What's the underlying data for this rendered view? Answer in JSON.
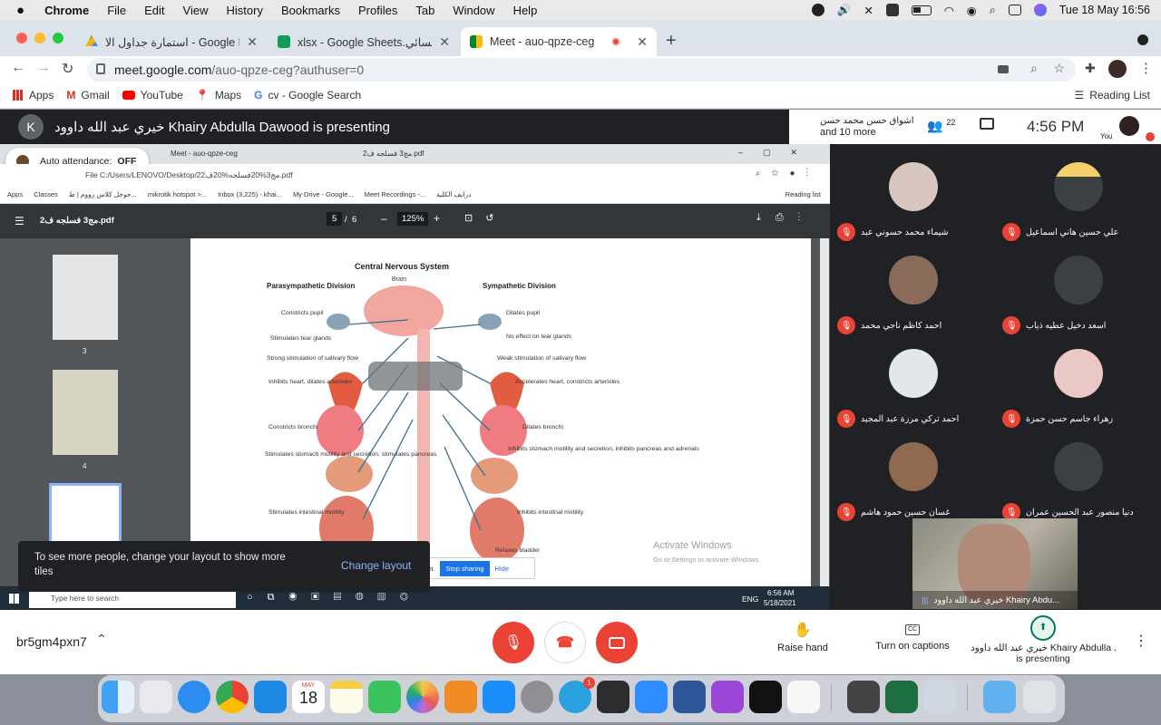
{
  "menubar": {
    "app": "Chrome",
    "items": [
      "File",
      "Edit",
      "View",
      "History",
      "Bookmarks",
      "Profiles",
      "Tab",
      "Window",
      "Help"
    ],
    "datetime": "Tue 18 May  16:56"
  },
  "tabs": [
    {
      "title": "استمارة جداول الا - Google Drive"
    },
    {
      "title": "xlsx - Google Sheets.المسائي"
    },
    {
      "title": "Meet - auo-qpze-ceg"
    }
  ],
  "address": {
    "host": "meet.google.com",
    "path": "/auo-qpze-ceg?authuser=0"
  },
  "bookmarks": {
    "items": [
      "Apps",
      "Gmail",
      "YouTube",
      "Maps",
      "cv - Google Search"
    ],
    "reading_list": "Reading List"
  },
  "presenter_bar": {
    "avatar_letter": "K",
    "text": "خيري عبد الله داوود Khairy Abdulla Dawood is presenting",
    "top_speaker": "اشواق حسن محمد حسن",
    "others": "and 10 more",
    "people_count": "22",
    "time": "4:56 PM",
    "you_label": "You"
  },
  "auto_attendance": {
    "label": "Auto attendance:",
    "state": "OFF"
  },
  "shared_screen": {
    "inner_tabs": [
      "Meet - auo-qpze-ceg",
      "مج3 فسلجه ف2.pdf"
    ],
    "inner_url": "File  C:/Users/LENOVO/Desktop/2مج3%20فسلجه%20ف2.pdf",
    "inner_bookmarks": [
      "Apps",
      "Classes",
      "جوجل كلاس رووم | ط...",
      "mikrotik hotspot >...",
      "Inbox (3,225) - khai...",
      "My Drive - Google...",
      "Meet Recordings -...",
      "درايف الكلية"
    ],
    "inner_reading_list": "Reading list",
    "pdf_title": "مج3 فسلجه ف2.pdf",
    "page_current": "5",
    "page_total": "6",
    "zoom": "125%",
    "thumbnail_labels": [
      "3",
      "4"
    ],
    "diagram": {
      "title": "Central Nervous System",
      "center": "Brain",
      "left_heading": "Parasympathetic Division",
      "right_heading": "Sympathetic Division",
      "left_labels": [
        "Constricts pupil",
        "Stimulates tear glands",
        "Strong stimulation of salivary flow",
        "Inhibits heart, dilates arterioles",
        "Constricts bronchi",
        "Stimulates stomach motility and secretion, stimulates pancreas",
        "Stimulates intestinal motility"
      ],
      "right_labels": [
        "Dilates pupil",
        "No effect on tear glands",
        "Weak stimulation of salivary flow",
        "Accelerates heart, constricts arterioles",
        "Dilates bronchi",
        "Inhibits stomach motility and secretion, inhibits pancreas and adrenals",
        "Inhibits intestinal motility",
        "Relaxes bladder"
      ]
    },
    "watermark_title": "Activate Windows",
    "watermark_sub": "Go to Settings to activate Windows.",
    "share_notice_end": "en.",
    "stop_sharing": "Stop sharing",
    "hide": "Hide",
    "win_search": "Type here to search",
    "win_lang": "ENG",
    "win_time": "6:56 AM",
    "win_date": "5/18/2021"
  },
  "toast": {
    "message": "To see more people, change your layout to show more tiles",
    "action": "Change layout"
  },
  "participants": [
    {
      "name": "شيماء محمد حسوني عبد",
      "photo": true
    },
    {
      "name": "علي حسين هاني اسماعيل",
      "photo": true
    },
    {
      "name": "احمد كاظم ناجي محمد",
      "photo": true
    },
    {
      "name": "اسعد دخيل عطيه ذياب",
      "photo": false
    },
    {
      "name": "احمد تركي مرزة عبد المجيد",
      "photo": true
    },
    {
      "name": "زهراء جاسم حسن حمزة",
      "photo": true
    },
    {
      "name": "غسان حسين حمود هاشم",
      "photo": true
    },
    {
      "name": "دنيا منصور عبد الحسين عمران",
      "photo": false
    }
  ],
  "presenter_tile": {
    "name": "خيري عبد الله داوود Khairy Abdu..."
  },
  "controls": {
    "meeting_code": "br5gm4pxn7",
    "raise_hand": "Raise hand",
    "captions": "Turn on captions",
    "presenting_name": "خيري عبد الله داوود Khairy Abdulla ...",
    "presenting_label": "is presenting"
  },
  "dock": {
    "calendar_month": "MAY",
    "calendar_day": "18",
    "telegram_badge": "1"
  },
  "colors": {
    "meet_bg": "#202124",
    "red": "#ea4335",
    "accent": "#1a73e8",
    "green_text": "#00796b"
  }
}
